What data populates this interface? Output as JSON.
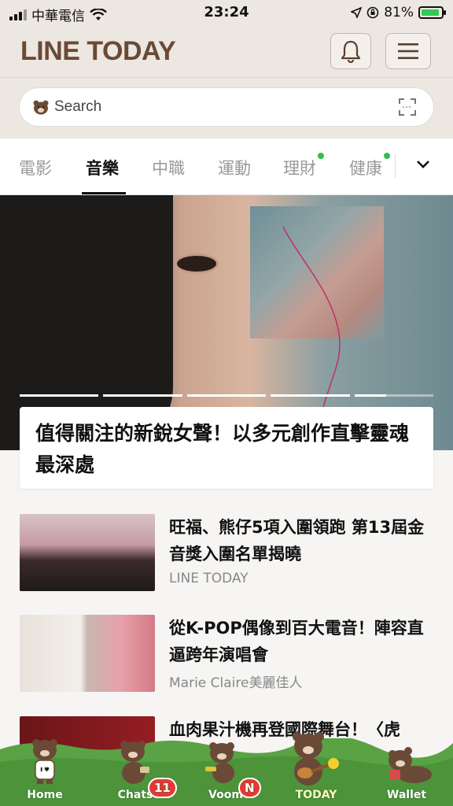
{
  "status_bar": {
    "carrier": "中華電信",
    "time": "23:24",
    "battery": "81%",
    "battery_level": 0.81
  },
  "header": {
    "logo": "LINE TODAY",
    "bell_icon": "bell-icon",
    "menu_icon": "hamburger-menu-icon"
  },
  "search": {
    "placeholder": "Search",
    "bear_icon": "brown-bear-icon",
    "scan_icon": "scan-icon"
  },
  "tabs": [
    {
      "label": "電影",
      "active": false,
      "dot": false
    },
    {
      "label": "音樂",
      "active": true,
      "dot": false
    },
    {
      "label": "中職",
      "active": false,
      "dot": false
    },
    {
      "label": "運動",
      "active": false,
      "dot": false
    },
    {
      "label": "理財",
      "active": false,
      "dot": true
    },
    {
      "label": "健康",
      "active": false,
      "dot": true
    }
  ],
  "hero": {
    "headline": "值得關注的新銳女聲！以多元創作直擊靈魂最深處",
    "slide_count": 5,
    "current_slide": 5
  },
  "news": [
    {
      "title": "旺福、熊仔5項入圍領跑 第13屆金音獎入圍名單揭曉",
      "source": "LINE TODAY"
    },
    {
      "title": "從K-POP偶像到百大電音！陣容直逼跨年演唱會",
      "source": "Marie Claire美麗佳人"
    },
    {
      "title": "血肉果汁機再登國際舞台！〈虎",
      "source": ""
    }
  ],
  "bottom_nav": [
    {
      "label": "Home",
      "badge": "",
      "active": false
    },
    {
      "label": "Chats",
      "badge": "11",
      "active": false
    },
    {
      "label": "Voom",
      "badge": "N",
      "active": false
    },
    {
      "label": "TODAY",
      "badge": "",
      "active": true
    },
    {
      "label": "Wallet",
      "badge": "",
      "active": false
    }
  ],
  "colors": {
    "brand_brown": "#6a4a37",
    "header_bg": "#ece7e0",
    "badge_red": "#e53935",
    "dot_green": "#2fbf4a",
    "grass_green": "#5aa345"
  }
}
